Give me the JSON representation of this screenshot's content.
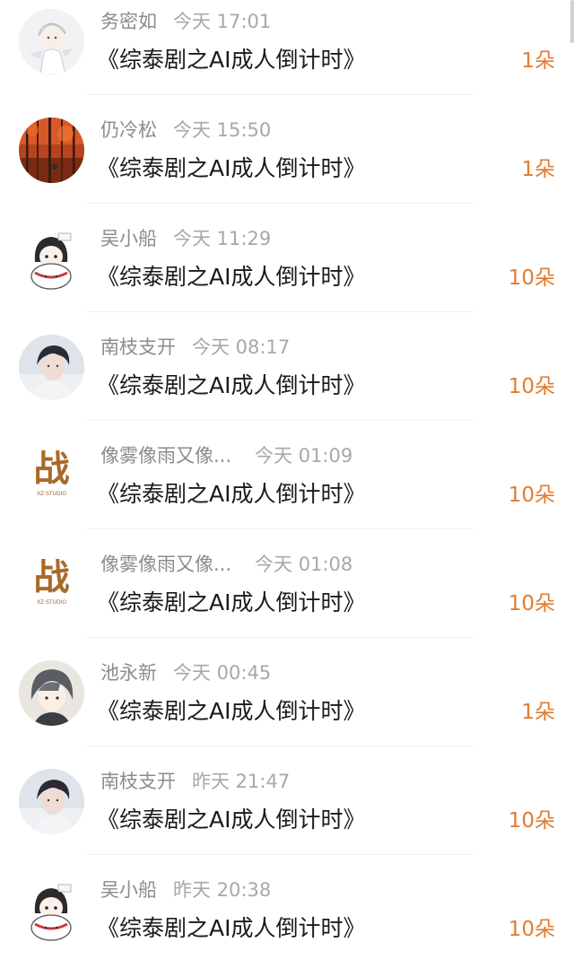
{
  "gift_list": [
    {
      "name": "务密如",
      "time": "今天 17:01",
      "title": "《综泰剧之AI成人倒计时》",
      "count": "1朵",
      "avatar": "white-haired-anime-boy"
    },
    {
      "name": "仍冷松",
      "time": "今天 15:50",
      "title": "《综泰剧之AI成人倒计时》",
      "count": "1朵",
      "avatar": "autumn-forest"
    },
    {
      "name": "吴小船",
      "time": "今天 11:29",
      "title": "《综泰剧之AI成人倒计时》",
      "count": "10朵",
      "avatar": "chibi-cat-girl"
    },
    {
      "name": "南枝支开",
      "time": "今天 08:17",
      "title": "《综泰剧之AI成人倒计时》",
      "count": "10朵",
      "avatar": "young-man-portrait"
    },
    {
      "name": "像雾像雨又像...",
      "time": "今天 01:09",
      "title": "《综泰剧之AI成人倒计时》",
      "count": "10朵",
      "avatar": "zhan-calligraphy"
    },
    {
      "name": "像雾像雨又像...",
      "time": "今天 01:08",
      "title": "《综泰剧之AI成人倒计时》",
      "count": "10朵",
      "avatar": "zhan-calligraphy"
    },
    {
      "name": "池永新",
      "time": "今天 00:45",
      "title": "《综泰剧之AI成人倒计时》",
      "count": "1朵",
      "avatar": "anime-boy-grey-hair"
    },
    {
      "name": "南枝支开",
      "time": "昨天 21:47",
      "title": "《综泰剧之AI成人倒计时》",
      "count": "10朵",
      "avatar": "young-man-portrait"
    },
    {
      "name": "吴小船",
      "time": "昨天 20:38",
      "title": "《综泰剧之AI成人倒计时》",
      "count": "10朵",
      "avatar": "chibi-cat-girl"
    }
  ],
  "avatar_art": {
    "zhan_character": "战",
    "zhan_subtitle": "XZ·STUDIO"
  },
  "colors": {
    "count_accent": "#e27b2f",
    "meta_text": "#9a9a9a",
    "title_text": "#1a1a1a"
  }
}
